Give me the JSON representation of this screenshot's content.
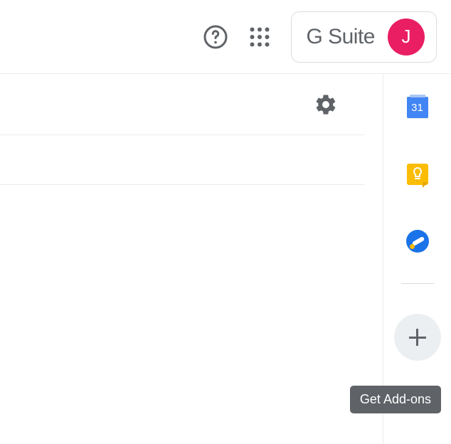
{
  "header": {
    "help_icon_name": "help",
    "apps_icon_name": "apps",
    "gsuite_label": "G Suite",
    "avatar_initial": "J"
  },
  "main": {
    "settings_icon_name": "settings"
  },
  "sidepanel": {
    "calendar": {
      "day": "31"
    },
    "keep_icon_name": "keep",
    "tasks_icon_name": "tasks",
    "addons_icon_name": "plus",
    "tooltip": "Get Add-ons"
  }
}
